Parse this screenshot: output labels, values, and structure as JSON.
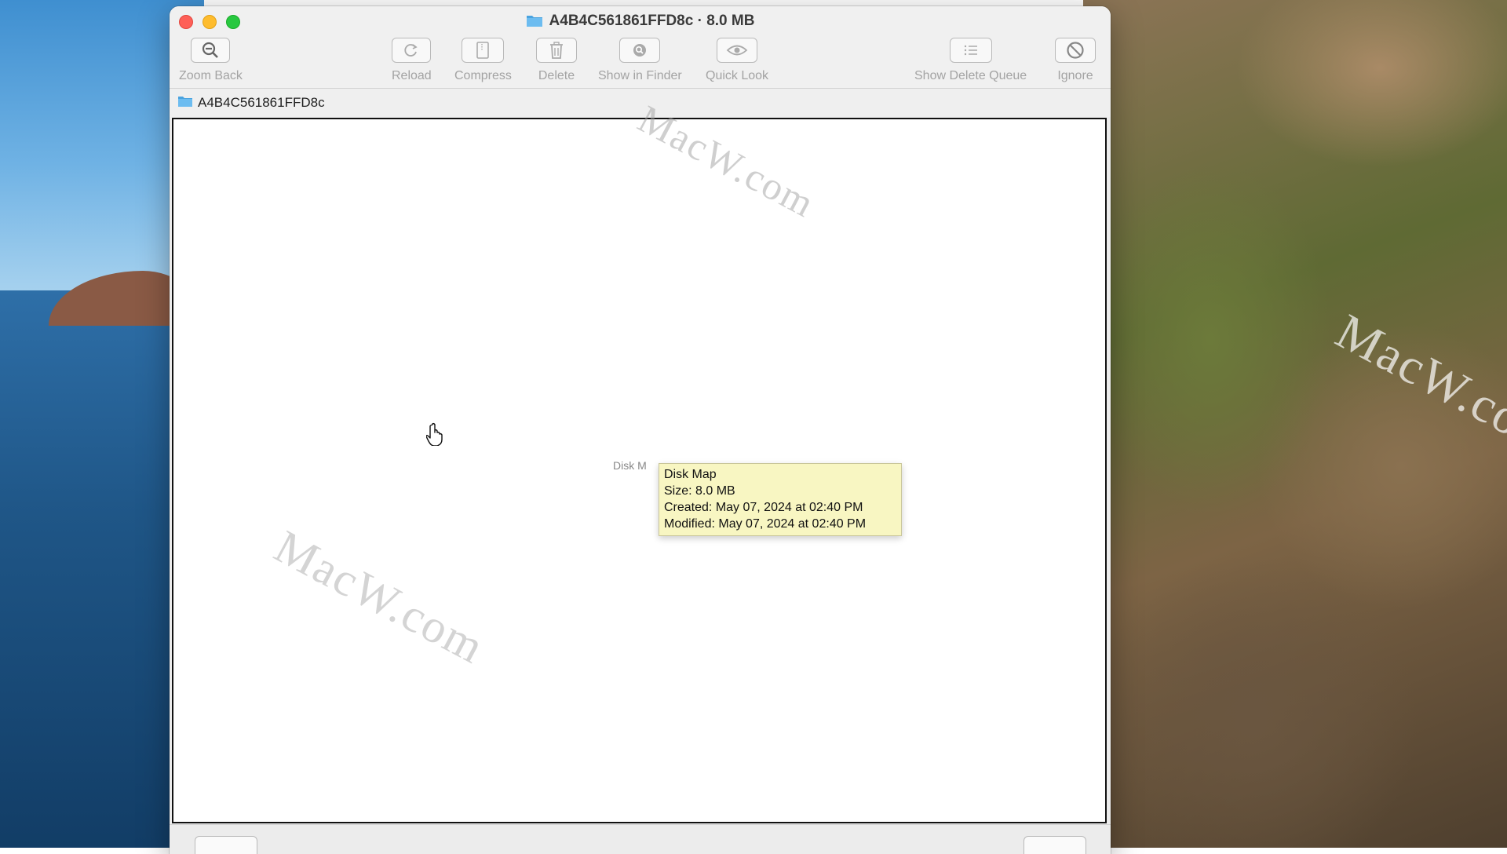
{
  "window": {
    "title": "A4B4C561861FFD8c · 8.0 MB"
  },
  "toolbar": {
    "zoom_back": "Zoom Back",
    "reload": "Reload",
    "compress": "Compress",
    "delete": "Delete",
    "show_in_finder": "Show in Finder",
    "quick_look": "Quick Look",
    "show_delete_queue": "Show Delete Queue",
    "ignore": "Ignore"
  },
  "pathbar": {
    "folder": "A4B4C561861FFD8c"
  },
  "map": {
    "label": "Disk M"
  },
  "tooltip": {
    "line1": "Disk Map",
    "line2": "Size: 8.0 MB",
    "line3": "Created: May 07, 2024 at 02:40 PM",
    "line4": "Modified: May 07, 2024 at 02:40 PM"
  },
  "watermark": {
    "text": "MacW.com"
  },
  "icons": {
    "zoom_back": "zoom-out-icon",
    "reload": "reload-icon",
    "compress": "compress-icon",
    "delete": "trash-icon",
    "show_in_finder": "finder-search-icon",
    "quick_look": "eye-icon",
    "show_delete_queue": "list-icon",
    "ignore": "prohibit-icon",
    "folder": "folder-icon"
  },
  "colors": {
    "close": "#fe5f57",
    "minimize": "#febc2e",
    "maximize": "#28c840",
    "tooltip_bg": "#f8f6c2",
    "folder": "#4aa3df"
  }
}
